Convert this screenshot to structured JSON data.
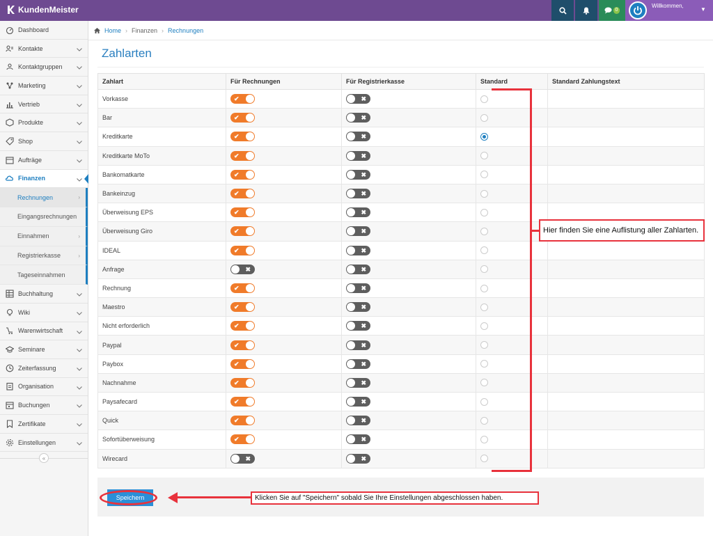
{
  "app": {
    "name": "KundenMeister",
    "welcome": "Willkommen,",
    "chat_count": "0"
  },
  "breadcrumb": [
    "Home",
    "Finanzen",
    "Rechnungen"
  ],
  "page_title": "Zahlarten",
  "sidebar": {
    "items": [
      {
        "label": "Dashboard",
        "icon": "dashboard-icon",
        "chevron": false
      },
      {
        "label": "Kontakte",
        "icon": "contacts-icon",
        "chevron": true
      },
      {
        "label": "Kontaktgruppen",
        "icon": "contact-groups-icon",
        "chevron": true
      },
      {
        "label": "Marketing",
        "icon": "marketing-icon",
        "chevron": true
      },
      {
        "label": "Vertrieb",
        "icon": "sales-icon",
        "chevron": true
      },
      {
        "label": "Produkte",
        "icon": "products-icon",
        "chevron": true
      },
      {
        "label": "Shop",
        "icon": "shop-icon",
        "chevron": true
      },
      {
        "label": "Aufträge",
        "icon": "orders-icon",
        "chevron": true
      },
      {
        "label": "Finanzen",
        "icon": "finance-icon",
        "chevron": true,
        "active": true
      }
    ],
    "sub_items": [
      {
        "label": "Rechnungen",
        "active": true,
        "arrow": true
      },
      {
        "label": "Eingangsrechnungen",
        "arrow": false
      },
      {
        "label": "Einnahmen",
        "arrow": true
      },
      {
        "label": "Registrierkasse",
        "arrow": true
      },
      {
        "label": "Tageseinnahmen",
        "arrow": false
      }
    ],
    "items_after": [
      {
        "label": "Buchhaltung",
        "icon": "accounting-icon",
        "chevron": true
      },
      {
        "label": "Wiki",
        "icon": "wiki-icon",
        "chevron": true
      },
      {
        "label": "Warenwirtschaft",
        "icon": "inventory-icon",
        "chevron": true
      },
      {
        "label": "Seminare",
        "icon": "seminars-icon",
        "chevron": true
      },
      {
        "label": "Zeiterfassung",
        "icon": "time-tracking-icon",
        "chevron": true
      },
      {
        "label": "Organisation",
        "icon": "organisation-icon",
        "chevron": true
      },
      {
        "label": "Buchungen",
        "icon": "bookings-icon",
        "chevron": true
      },
      {
        "label": "Zertifikate",
        "icon": "certificates-icon",
        "chevron": true
      },
      {
        "label": "Einstellungen",
        "icon": "settings-icon",
        "chevron": true
      }
    ],
    "collapse_label": "«"
  },
  "table": {
    "headers": [
      "Zahlart",
      "Für Rechnungen",
      "Für Registrierkasse",
      "Standard",
      "Standard Zahlungstext"
    ],
    "rows": [
      {
        "name": "Vorkasse",
        "invoice": true,
        "register": false,
        "default": false
      },
      {
        "name": "Bar",
        "invoice": true,
        "register": false,
        "default": false
      },
      {
        "name": "Kreditkarte",
        "invoice": true,
        "register": false,
        "default": true
      },
      {
        "name": "Kreditkarte MoTo",
        "invoice": true,
        "register": false,
        "default": false
      },
      {
        "name": "Bankomatkarte",
        "invoice": true,
        "register": false,
        "default": false
      },
      {
        "name": "Bankeinzug",
        "invoice": true,
        "register": false,
        "default": false
      },
      {
        "name": "Überweisung EPS",
        "invoice": true,
        "register": false,
        "default": false
      },
      {
        "name": "Überweisung Giro",
        "invoice": true,
        "register": false,
        "default": false
      },
      {
        "name": "IDEAL",
        "invoice": true,
        "register": false,
        "default": false
      },
      {
        "name": "Anfrage",
        "invoice": false,
        "register": false,
        "default": false
      },
      {
        "name": "Rechnung",
        "invoice": true,
        "register": false,
        "default": false
      },
      {
        "name": "Maestro",
        "invoice": true,
        "register": false,
        "default": false
      },
      {
        "name": "Nicht erforderlich",
        "invoice": true,
        "register": false,
        "default": false
      },
      {
        "name": "Paypal",
        "invoice": true,
        "register": false,
        "default": false
      },
      {
        "name": "Paybox",
        "invoice": true,
        "register": false,
        "default": false
      },
      {
        "name": "Nachnahme",
        "invoice": true,
        "register": false,
        "default": false
      },
      {
        "name": "Paysafecard",
        "invoice": true,
        "register": false,
        "default": false
      },
      {
        "name": "Quick",
        "invoice": true,
        "register": false,
        "default": false
      },
      {
        "name": "Sofortüberweisung",
        "invoice": true,
        "register": false,
        "default": false
      },
      {
        "name": "Wirecard",
        "invoice": false,
        "register": false,
        "default": false
      }
    ]
  },
  "save_label": "Speichern",
  "annotations": {
    "list": "Hier finden Sie eine Auflistung aller Zahlarten.",
    "save": "Klicken Sie auf \"Speichern\" sobald Sie Ihre Einstellungen abgeschlossen haben."
  },
  "colors": {
    "topbar": "#6e4a91",
    "accent": "#1e7fc0",
    "toggle_on": "#f07b2a",
    "toggle_off": "#5e5e5e",
    "annotation_red": "#e8323c"
  }
}
